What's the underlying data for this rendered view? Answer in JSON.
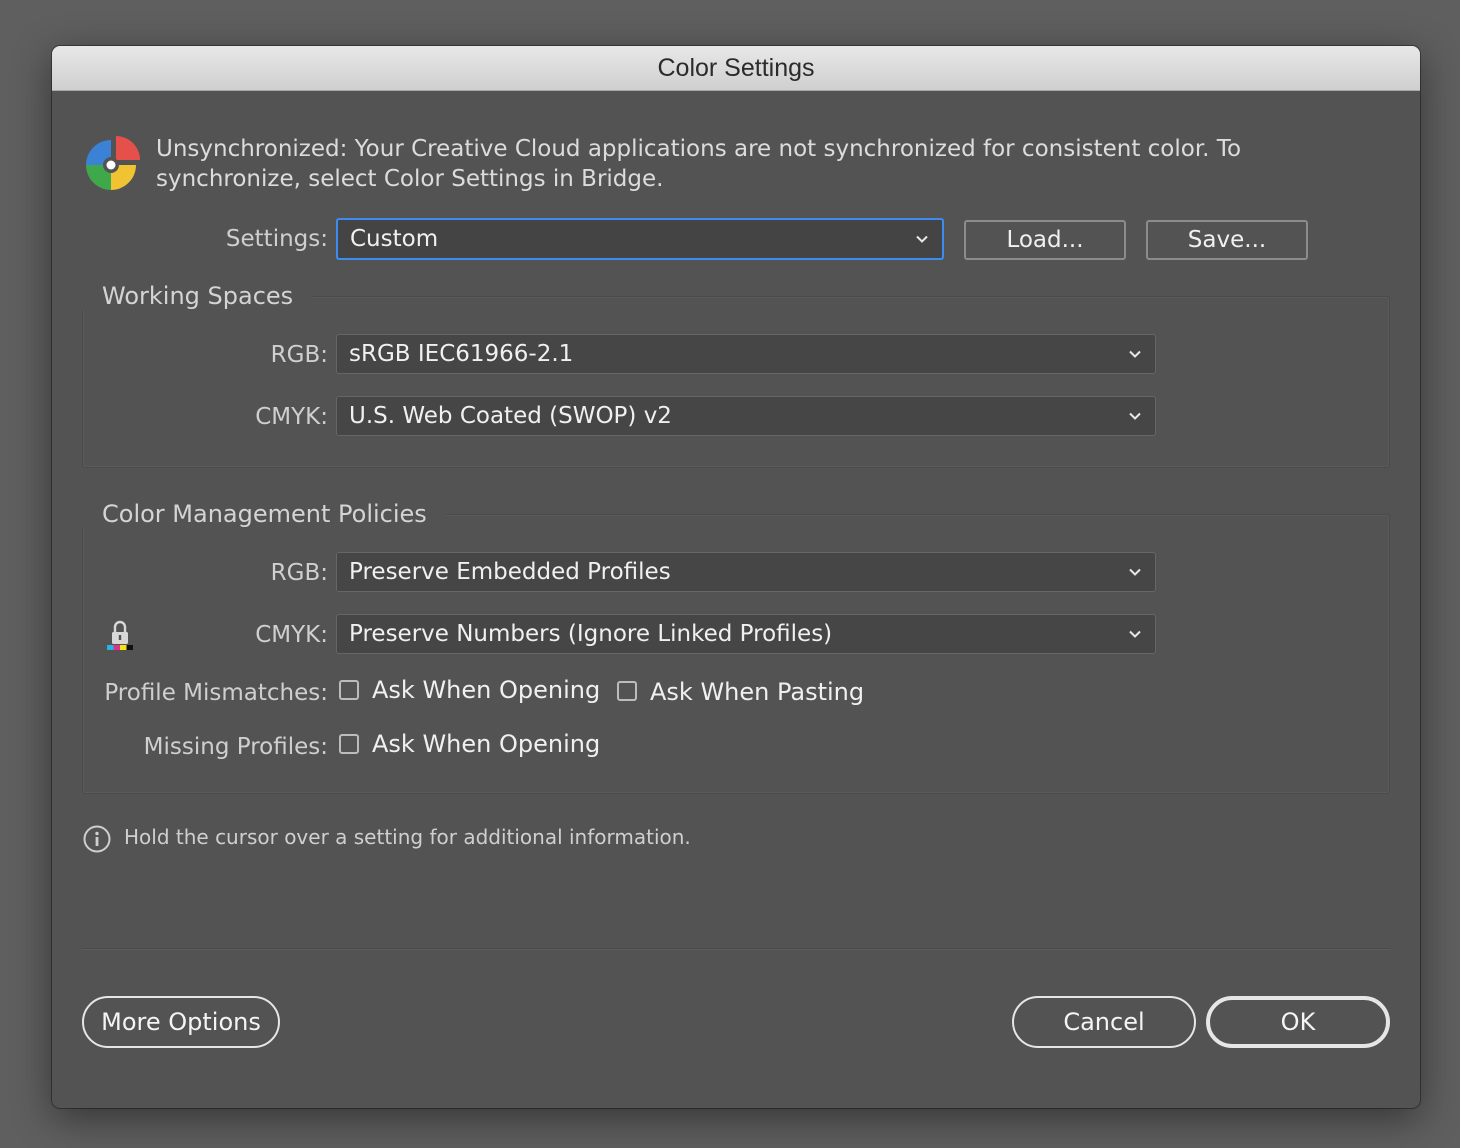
{
  "window": {
    "title": "Color Settings"
  },
  "sync": {
    "icon": "color-sync-icon",
    "message": "Unsynchronized: Your Creative Cloud applications are not synchronized for consistent color. To synchronize, select Color Settings in Bridge."
  },
  "settings": {
    "label": "Settings:",
    "value": "Custom",
    "load_label": "Load...",
    "save_label": "Save..."
  },
  "working_spaces": {
    "title": "Working Spaces",
    "rgb_label": "RGB:",
    "rgb_value": "sRGB IEC61966-2.1",
    "cmyk_label": "CMYK:",
    "cmyk_value": "U.S. Web Coated (SWOP) v2"
  },
  "policies": {
    "title": "Color Management Policies",
    "rgb_label": "RGB:",
    "rgb_value": "Preserve Embedded Profiles",
    "cmyk_label": "CMYK:",
    "cmyk_value": "Preserve Numbers (Ignore Linked Profiles)",
    "lock_icon": "cmyk-lock-icon",
    "profile_mismatches_label": "Profile Mismatches:",
    "mismatch_ask_opening": {
      "label": "Ask When Opening",
      "checked": false
    },
    "mismatch_ask_pasting": {
      "label": "Ask When Pasting",
      "checked": false
    },
    "missing_profiles_label": "Missing Profiles:",
    "missing_ask_opening": {
      "label": "Ask When Opening",
      "checked": false
    }
  },
  "info": {
    "icon": "info-icon",
    "text": "Hold the cursor over a setting for additional information."
  },
  "footer": {
    "more_options_label": "More Options",
    "cancel_label": "Cancel",
    "ok_label": "OK"
  }
}
